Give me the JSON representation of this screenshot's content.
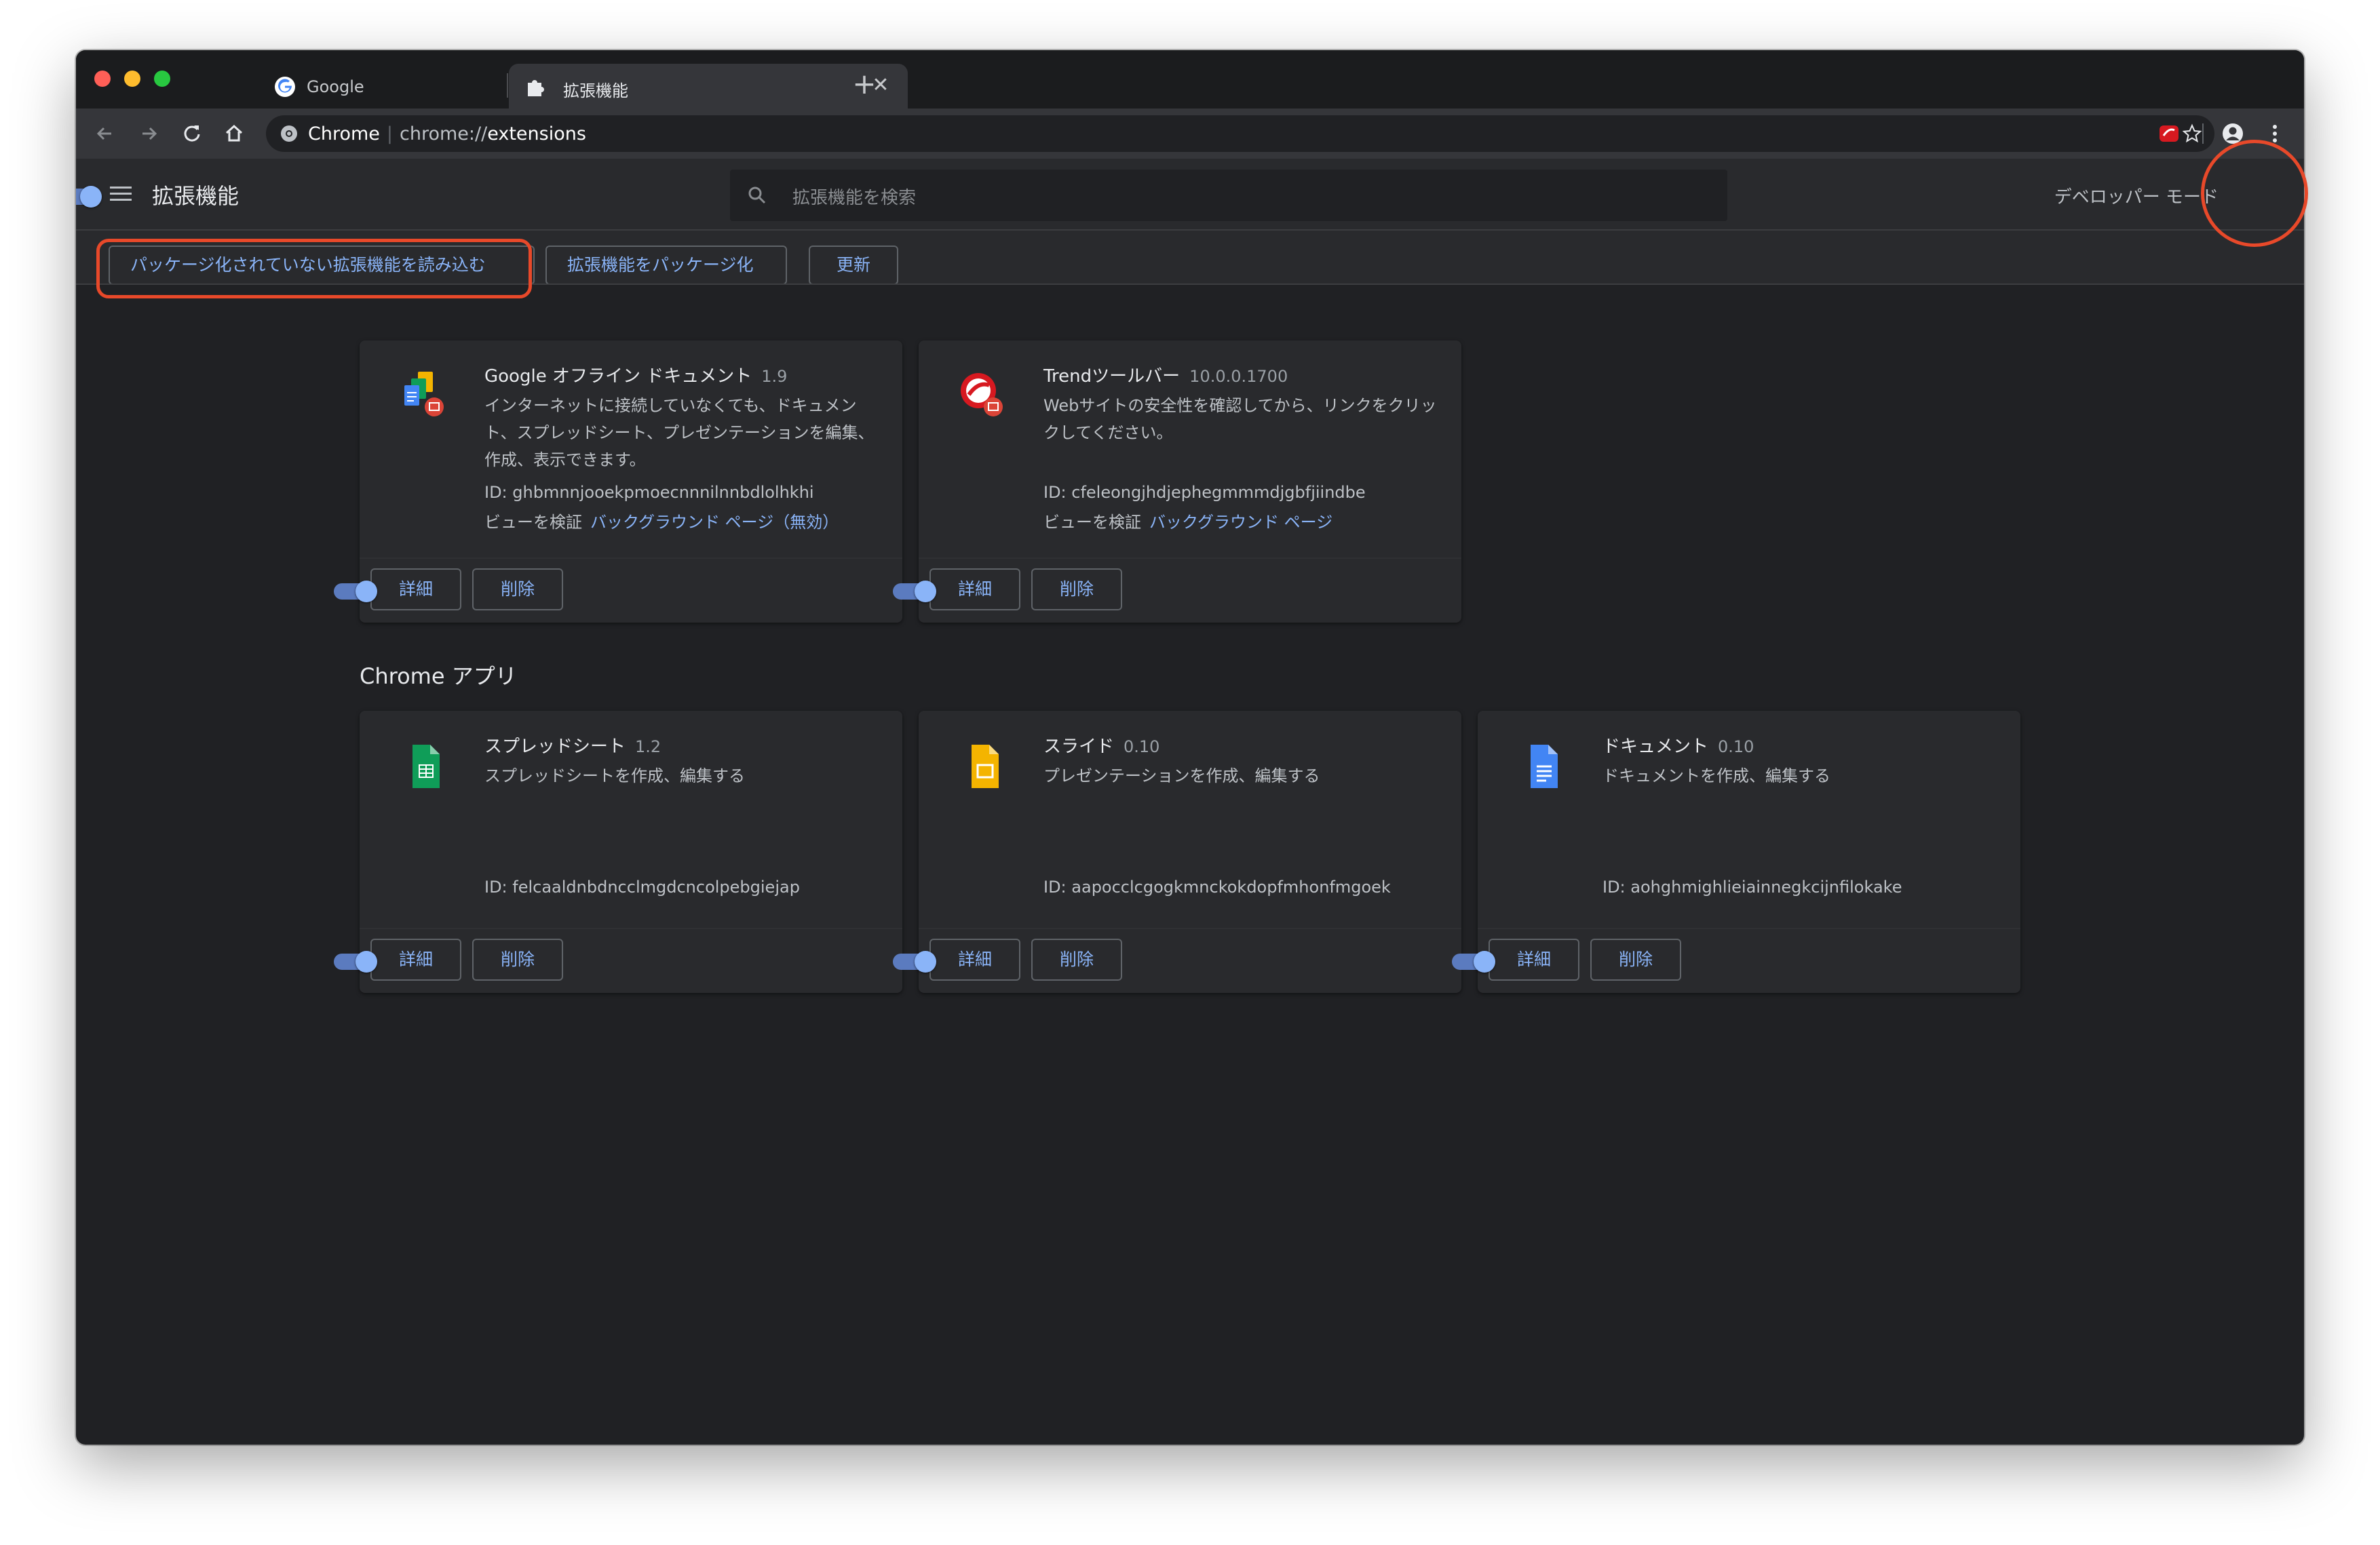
{
  "browser": {
    "tabs": [
      {
        "title": "Google",
        "active": false
      },
      {
        "title": "拡張機能",
        "active": true
      }
    ],
    "omnibox": {
      "site": "Chrome",
      "url_prefix": "chrome://",
      "url_path": "extensions"
    }
  },
  "header": {
    "title": "拡張機能",
    "search_placeholder": "拡張機能を検索",
    "developer_mode_label": "デベロッパー モード",
    "developer_mode_on": true,
    "buttons": {
      "load_unpacked": "パッケージ化されていない拡張機能を読み込む",
      "pack": "拡張機能をパッケージ化",
      "update": "更新"
    }
  },
  "extensions": [
    {
      "name": "Google オフライン ドキュメント",
      "version": "1.9",
      "description": "インターネットに接続していなくても、ドキュメント、スプレッドシート、プレゼンテーションを編集、作成、表示できます。",
      "id_label": "ID: ghbmnnjooekpmoecnnnilnnbdlolhkhi",
      "views_label": "ビューを検証",
      "views_link": "バックグラウンド ページ（無効）",
      "detail": "詳細",
      "remove": "削除",
      "enabled": true
    },
    {
      "name": "Trendツールバー",
      "version": "10.0.0.1700",
      "description": "Webサイトの安全性を確認してから、リンクをクリックしてください。",
      "id_label": "ID: cfeleongjhdjephegmmmdjgbfjiindbe",
      "views_label": "ビューを検証",
      "views_link": "バックグラウンド ページ",
      "detail": "詳細",
      "remove": "削除",
      "enabled": true
    }
  ],
  "apps_section_title": "Chrome アプリ",
  "apps": [
    {
      "name": "スプレッドシート",
      "version": "1.2",
      "description": "スプレッドシートを作成、編集する",
      "id_label": "ID: felcaaldnbdncclmgdcncolpebgiejap",
      "detail": "詳細",
      "remove": "削除",
      "enabled": true,
      "color": "#0f9d58"
    },
    {
      "name": "スライド",
      "version": "0.10",
      "description": "プレゼンテーションを作成、編集する",
      "id_label": "ID: aapocclcgogkmnckokdopfmhonfmgoek",
      "detail": "詳細",
      "remove": "削除",
      "enabled": true,
      "color": "#f4b400"
    },
    {
      "name": "ドキュメント",
      "version": "0.10",
      "description": "ドキュメントを作成、編集する",
      "id_label": "ID: aohghmighlieiainnegkcijnfilokake",
      "detail": "詳細",
      "remove": "削除",
      "enabled": true,
      "color": "#4285f4"
    }
  ],
  "colors": {
    "accent": "#8ab4f8",
    "highlight": "#e8492a",
    "background": "#202124",
    "card": "#292a2d"
  }
}
